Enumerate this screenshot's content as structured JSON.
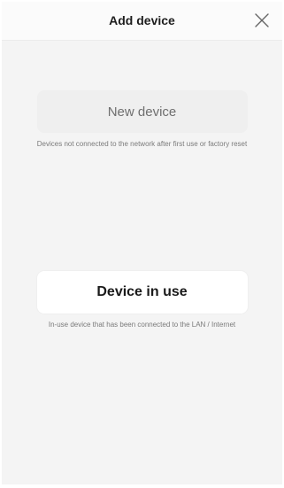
{
  "header": {
    "title": "Add device",
    "close_icon": "close-icon"
  },
  "options": {
    "new_device": {
      "label": "New device",
      "description": "Devices not connected to the network after first use or factory reset"
    },
    "device_in_use": {
      "label": "Device in use",
      "description": "In-use device that has been connected to the LAN / Internet"
    }
  },
  "colors": {
    "background": "#f4f4f4",
    "header_bg": "#fbfbfb",
    "button_inactive_bg": "#efefef",
    "button_active_bg": "#ffffff",
    "text_primary": "#1a1a1a",
    "text_secondary": "#7a7a7a"
  }
}
